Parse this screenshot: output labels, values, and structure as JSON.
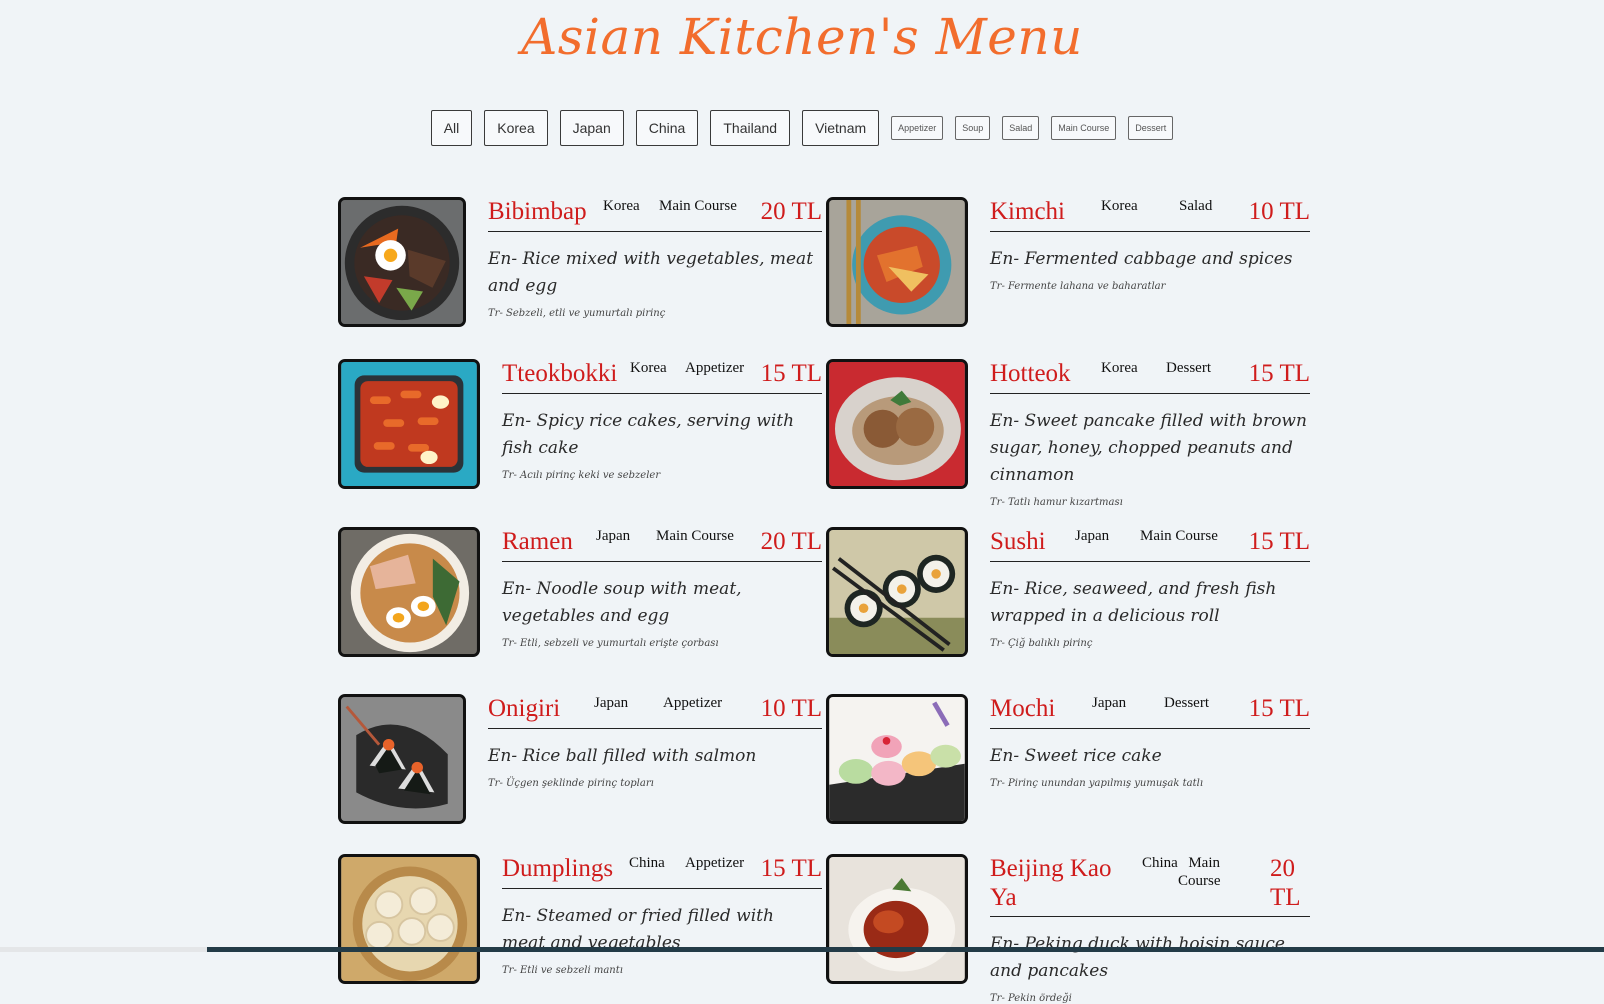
{
  "title": "Asian Kitchen's Menu",
  "filters": {
    "countries": [
      "All",
      "Korea",
      "Japan",
      "China",
      "Thailand",
      "Vietnam"
    ],
    "categories": [
      "Appetizer",
      "Soup",
      "Salad",
      "Main Course",
      "Dessert"
    ]
  },
  "items": [
    {
      "name": "Bibimbap",
      "country": "Korea",
      "category": "Main Course",
      "price": "20 TL",
      "en": "En- Rice mixed with vegetables, meat and egg",
      "tr": "Tr- Sebzeli, etli ve yumurtalı pirinç"
    },
    {
      "name": "Kimchi",
      "country": "Korea",
      "category": "Salad",
      "price": "10 TL",
      "en": "En- Fermented cabbage and spices",
      "tr": "Tr- Fermente lahana ve baharatlar"
    },
    {
      "name": "Tteokbokki",
      "country": "Korea",
      "category": "Appetizer",
      "price": "15 TL",
      "en": "En- Spicy rice cakes, serving with fish cake",
      "tr": "Tr- Acılı pirinç keki ve sebzeler"
    },
    {
      "name": "Hotteok",
      "country": "Korea",
      "category": "Dessert",
      "price": "15 TL",
      "en": "En- Sweet pancake filled with brown sugar, honey, chopped peanuts and cinnamon",
      "tr": "Tr- Tatlı hamur kızartması"
    },
    {
      "name": "Ramen",
      "country": "Japan",
      "category": "Main Course",
      "price": "20 TL",
      "en": "En- Noodle soup with meat, vegetables and egg",
      "tr": "Tr- Etli, sebzeli ve yumurtalı erişte çorbası"
    },
    {
      "name": "Sushi",
      "country": "Japan",
      "category": "Main Course",
      "price": "15 TL",
      "en": "En- Rice, seaweed, and fresh fish wrapped in a delicious roll",
      "tr": "Tr- Çiğ balıklı pirinç"
    },
    {
      "name": "Onigiri",
      "country": "Japan",
      "category": "Appetizer",
      "price": "10 TL",
      "en": "En- Rice ball filled with salmon",
      "tr": "Tr- Üçgen şeklinde pirinç topları"
    },
    {
      "name": "Mochi",
      "country": "Japan",
      "category": "Dessert",
      "price": "15 TL",
      "en": "En- Sweet rice cake",
      "tr": "Tr- Pirinç unundan yapılmış yumuşak tatlı"
    },
    {
      "name": "Dumplings",
      "country": "China",
      "category": "Appetizer",
      "price": "15 TL",
      "en": "En- Steamed or fried filled with meat and vegetables",
      "tr": "Tr- Etli ve sebzeli mantı"
    },
    {
      "name": "Beijing Kao Ya",
      "country": "China",
      "category": "Main Course",
      "price": "20 TL",
      "en": "En- Peking duck with hoisin sauce and pancakes",
      "tr": "Tr- Pekin ördeği"
    }
  ],
  "colors": {
    "accent": "#f26d2d",
    "price": "#cf1c1c",
    "background": "#f0f4f7"
  }
}
